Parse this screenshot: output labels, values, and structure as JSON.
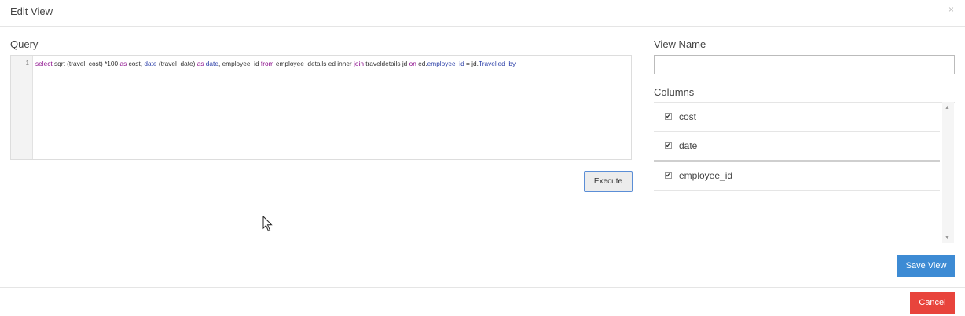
{
  "dialog": {
    "title": "Edit View",
    "close_glyph": "×"
  },
  "query": {
    "label": "Query",
    "line_number": "1",
    "tokens": [
      {
        "t": "select",
        "c": "kw"
      },
      {
        "t": " sqrt (travel_cost) *100 ",
        "c": ""
      },
      {
        "t": "as",
        "c": "kw"
      },
      {
        "t": " cost, ",
        "c": ""
      },
      {
        "t": "date",
        "c": "fn"
      },
      {
        "t": " (travel_date) ",
        "c": ""
      },
      {
        "t": "as",
        "c": "kw"
      },
      {
        "t": " ",
        "c": ""
      },
      {
        "t": "date",
        "c": "fn"
      },
      {
        "t": ",  employee_id ",
        "c": ""
      },
      {
        "t": "from",
        "c": "kw"
      },
      {
        "t": " employee_details ed inner ",
        "c": ""
      },
      {
        "t": "join",
        "c": "kw"
      },
      {
        "t": " traveldetails jd ",
        "c": ""
      },
      {
        "t": "on",
        "c": "kw"
      },
      {
        "t": " ed.",
        "c": ""
      },
      {
        "t": "employee_id",
        "c": "fn"
      },
      {
        "t": " = jd.",
        "c": ""
      },
      {
        "t": "Travelled_by",
        "c": "fn"
      }
    ],
    "execute_label": "Execute"
  },
  "view": {
    "name_label": "View Name",
    "name_value": "",
    "columns_label": "Columns",
    "columns": [
      {
        "name": "cost",
        "checked": true
      },
      {
        "name": "date",
        "checked": true
      },
      {
        "name": "employee_id",
        "checked": true
      }
    ],
    "save_label": "Save View"
  },
  "footer": {
    "cancel_label": "Cancel"
  },
  "colors": {
    "save": "#3d8bd4",
    "cancel": "#e8443c",
    "keyword": "#8b0a8b",
    "function": "#2b3fa8"
  }
}
